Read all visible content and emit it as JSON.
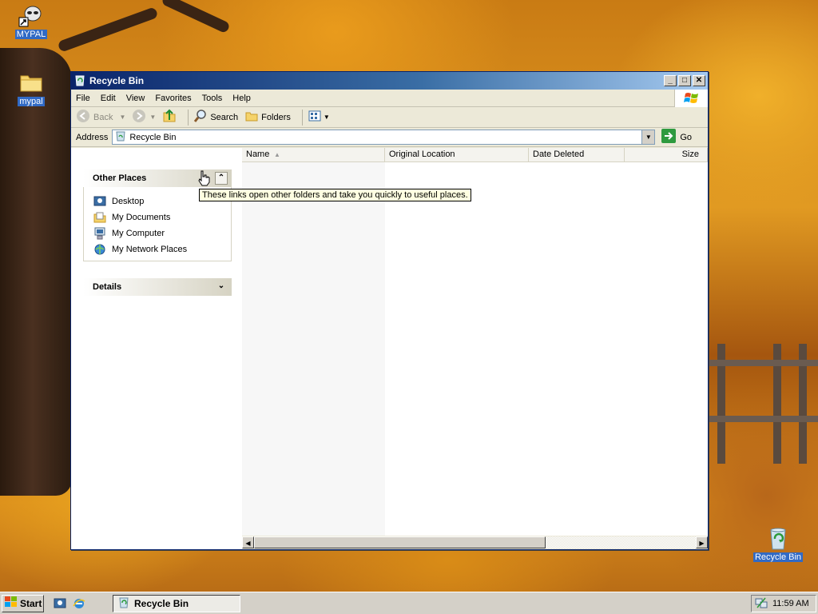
{
  "desktop": {
    "icons": [
      {
        "label": "MYPAL",
        "icon": "mypal-shortcut-icon"
      },
      {
        "label": "mypal",
        "icon": "folder-icon"
      },
      {
        "label": "Recycle Bin",
        "icon": "recycle-bin-icon"
      }
    ]
  },
  "window": {
    "title": "Recycle Bin",
    "controls": {
      "minimize": "_",
      "maximize": "□",
      "close": "✕"
    },
    "menu": [
      "File",
      "Edit",
      "View",
      "Favorites",
      "Tools",
      "Help"
    ],
    "toolbar": {
      "back_label": "Back",
      "search_label": "Search",
      "folders_label": "Folders"
    },
    "address": {
      "label": "Address",
      "value": "Recycle Bin",
      "go_label": "Go"
    },
    "taskpane": {
      "other_places": {
        "title": "Other Places",
        "items": [
          "Desktop",
          "My Documents",
          "My Computer",
          "My Network Places"
        ]
      },
      "details": {
        "title": "Details"
      }
    },
    "filelist": {
      "columns": [
        "Name",
        "Original Location",
        "Date Deleted",
        "Size"
      ]
    },
    "tooltip": "These links open other folders and take you quickly to useful places."
  },
  "taskbar": {
    "start_label": "Start",
    "task_item": "Recycle Bin",
    "clock": "11:59 AM"
  },
  "colors": {
    "titlebar": "#0a246a",
    "face": "#ece9d8",
    "selection": "#316ac5",
    "tooltip_bg": "#ffffe1"
  }
}
